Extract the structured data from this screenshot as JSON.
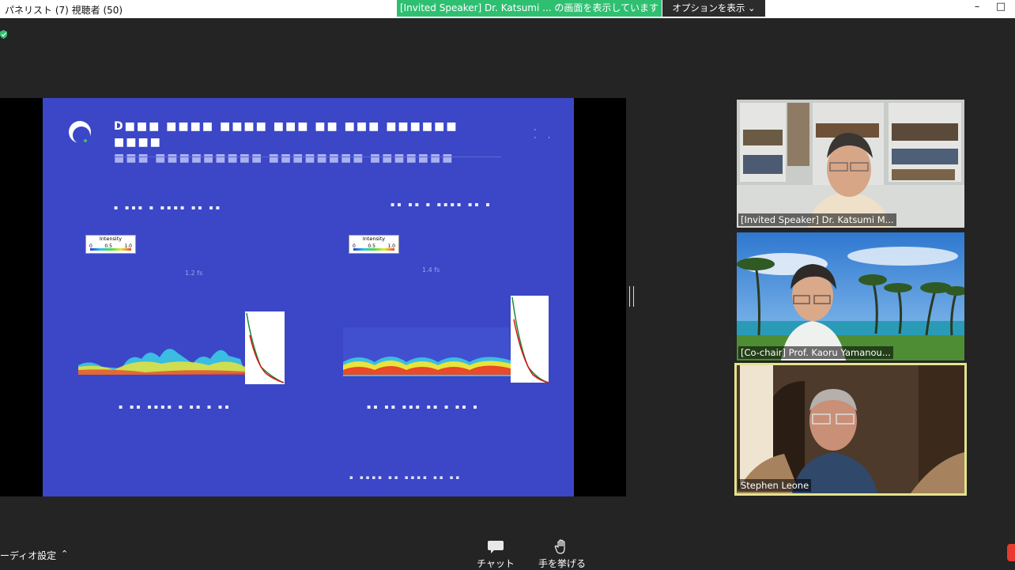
{
  "window": {
    "title": "パネリスト (7) 視聴者 (50)"
  },
  "share_banner": {
    "status": "[Invited Speaker] Dr. Katsumi ... の画面を表示しています",
    "options_label": "オプションを表示"
  },
  "slide": {
    "legend_left": {
      "title": "Intensity",
      "ticks": [
        "0",
        "0.5",
        "1.0"
      ]
    },
    "legend_right": {
      "title": "Intensity",
      "ticks": [
        "0",
        "0.5",
        "1.0"
      ]
    }
  },
  "participants": [
    {
      "name": "[Invited Speaker] Dr. Katsumi M...",
      "speaking": false
    },
    {
      "name": "[Co-chair] Prof. Kaoru Yamanou...",
      "speaking": false
    },
    {
      "name": "Stephen Leone",
      "speaking": true
    }
  ],
  "toolbar": {
    "audio_settings": "ーディオ設定",
    "chat": "チャット",
    "raise_hand": "手を挙げる"
  },
  "colors": {
    "slide_background": "#3b47c7",
    "share_banner": "#2fbf71",
    "active_speaker_border": "#e4e38c",
    "end_button": "#e63b2e"
  },
  "icons": [
    "shield-icon",
    "chevron-down-icon",
    "minimize-icon",
    "maximize-icon",
    "chat-icon",
    "hand-icon"
  ]
}
